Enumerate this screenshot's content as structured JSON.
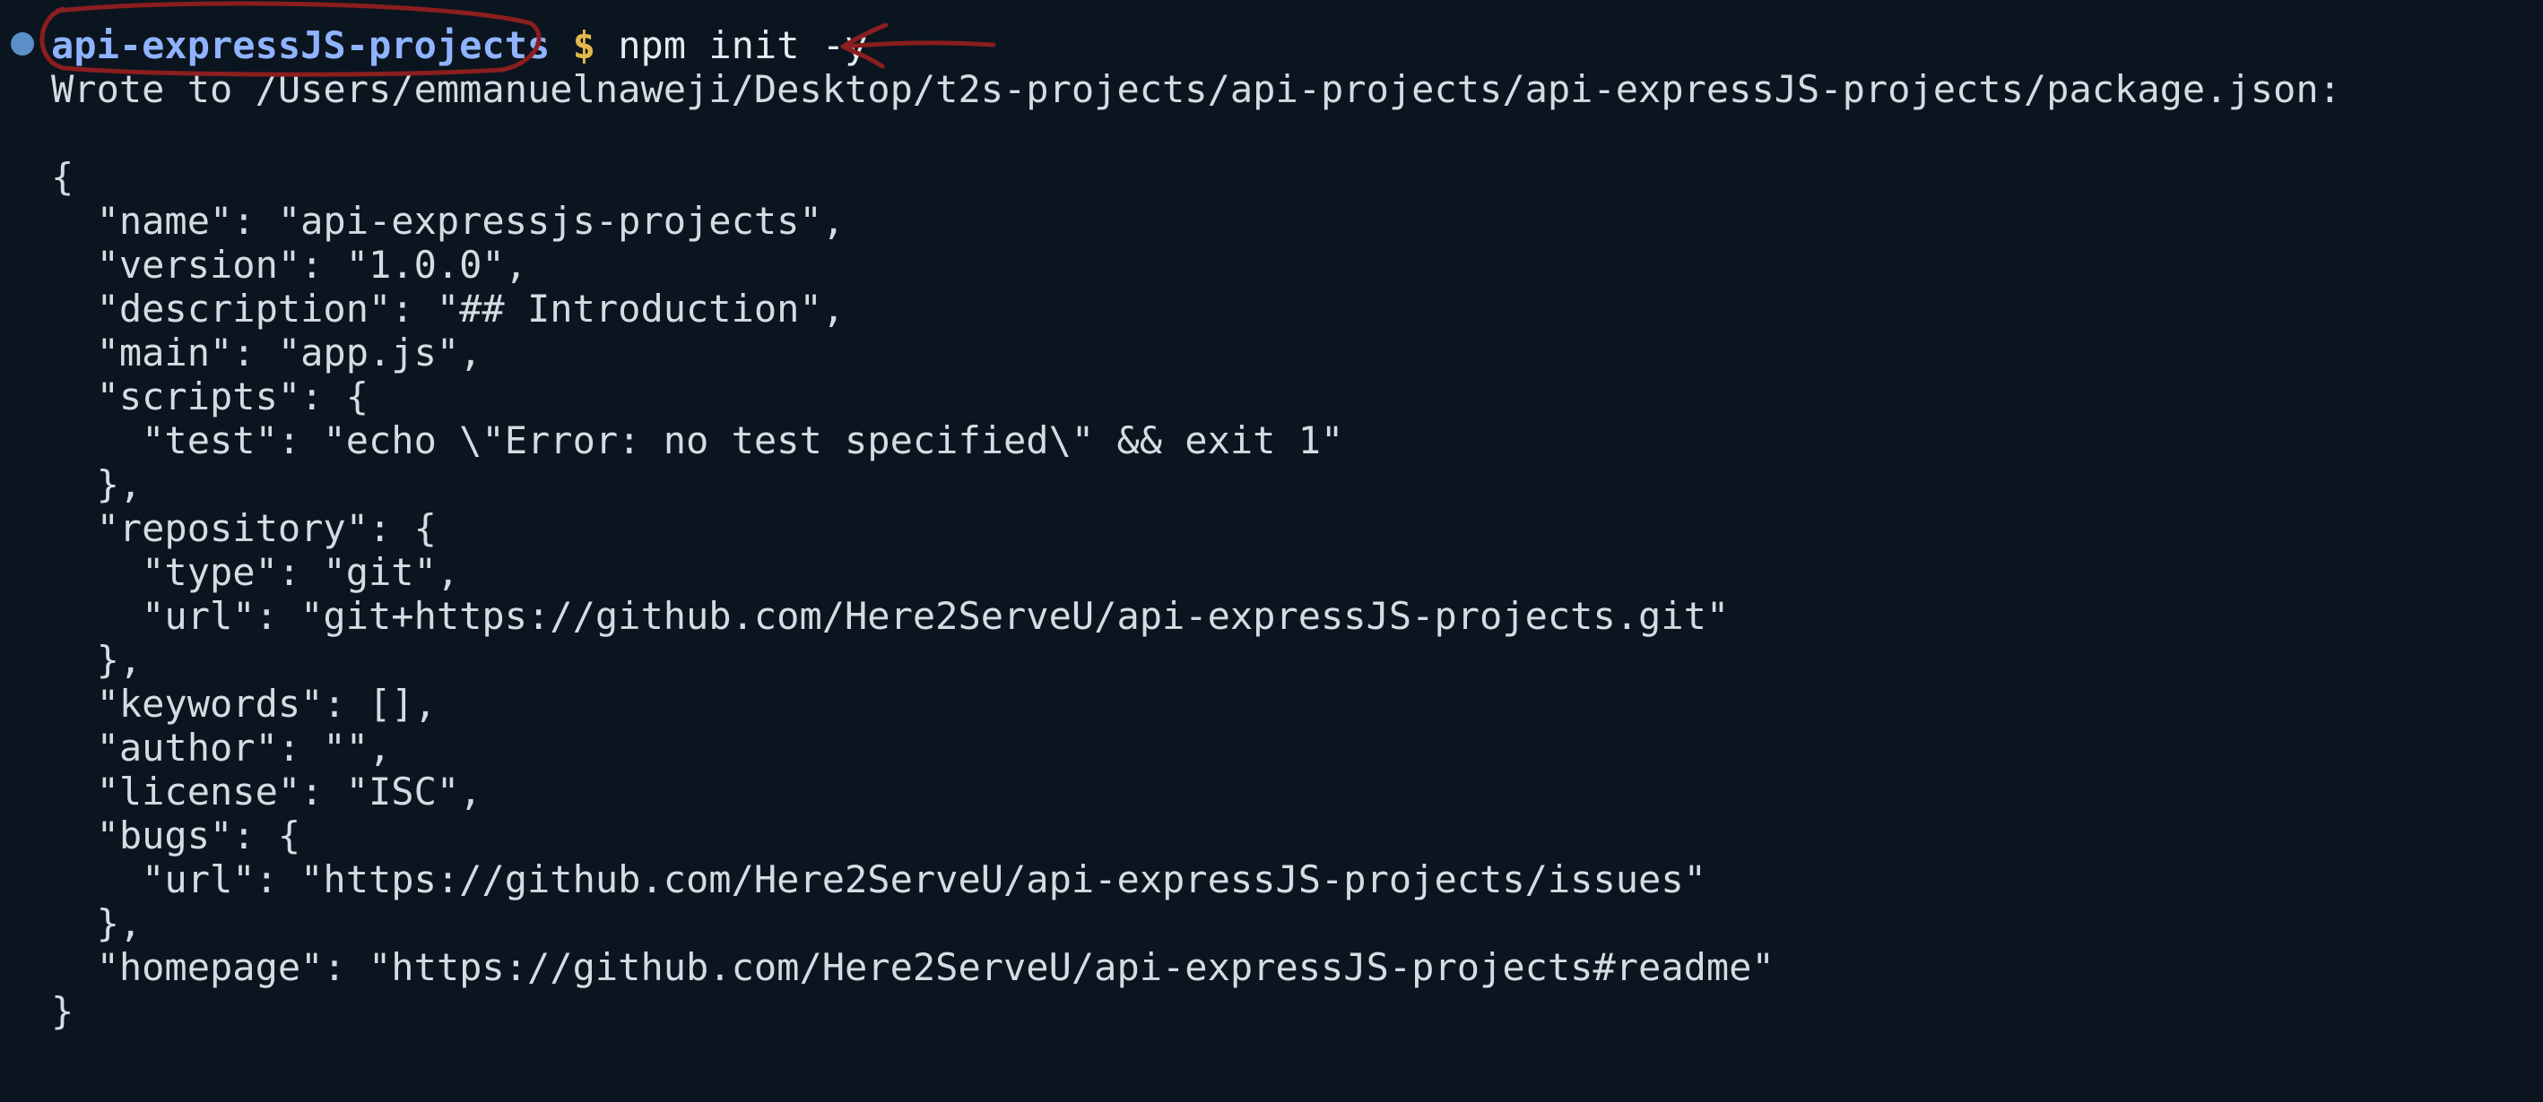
{
  "prompt": {
    "directory": "api-expressJS-projects",
    "symbol": "$",
    "command": "npm init -y"
  },
  "output": {
    "lines": [
      "Wrote to /Users/emmanuelnaweji/Desktop/t2s-projects/api-projects/api-expressJS-projects/package.json:",
      "",
      "{",
      "  \"name\": \"api-expressjs-projects\",",
      "  \"version\": \"1.0.0\",",
      "  \"description\": \"## Introduction\",",
      "  \"main\": \"app.js\",",
      "  \"scripts\": {",
      "    \"test\": \"echo \\\"Error: no test specified\\\" && exit 1\"",
      "  },",
      "  \"repository\": {",
      "    \"type\": \"git\",",
      "    \"url\": \"git+https://github.com/Here2ServeU/api-expressJS-projects.git\"",
      "  },",
      "  \"keywords\": [],",
      "  \"author\": \"\",",
      "  \"license\": \"ISC\",",
      "  \"bugs\": {",
      "    \"url\": \"https://github.com/Here2ServeU/api-expressJS-projects/issues\"",
      "  },",
      "  \"homepage\": \"https://github.com/Here2ServeU/api-expressJS-projects#readme\"",
      "}"
    ]
  },
  "colors": {
    "background": "#0b1520",
    "directory": "#8fb3ff",
    "dollar": "#e4b84a",
    "text": "#d6dbe1",
    "annotation": "#8b1e1e"
  }
}
